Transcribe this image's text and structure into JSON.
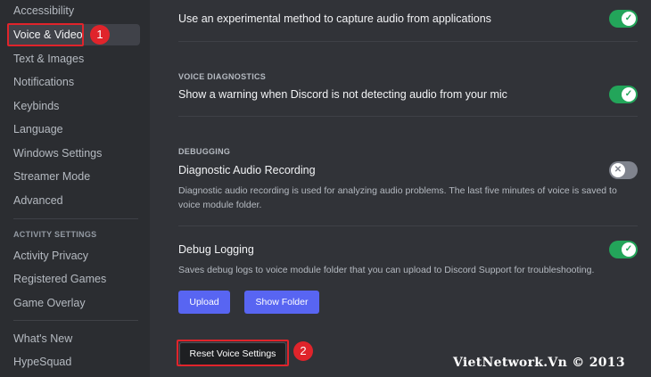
{
  "sidebar": {
    "items_top": [
      {
        "label": "Accessibility"
      },
      {
        "label": "Voice & Video",
        "selected": true
      },
      {
        "label": "Text & Images"
      },
      {
        "label": "Notifications"
      },
      {
        "label": "Keybinds"
      },
      {
        "label": "Language"
      },
      {
        "label": "Windows Settings"
      },
      {
        "label": "Streamer Mode"
      },
      {
        "label": "Advanced"
      }
    ],
    "activity_header": "ACTIVITY SETTINGS",
    "activity_items": [
      {
        "label": "Activity Privacy"
      },
      {
        "label": "Registered Games"
      },
      {
        "label": "Game Overlay"
      }
    ],
    "bottom_items": [
      {
        "label": "What's New"
      },
      {
        "label": "HypeSquad"
      }
    ]
  },
  "annotations": {
    "step1": "1",
    "step2": "2",
    "highlight_color": "#e0242b"
  },
  "main": {
    "experimental_capture": {
      "label": "Use an experimental method to capture audio from applications",
      "enabled": true
    },
    "voice_diagnostics": {
      "header": "VOICE DIAGNOSTICS",
      "label": "Show a warning when Discord is not detecting audio from your mic",
      "enabled": true
    },
    "debugging": {
      "header": "DEBUGGING",
      "diagnostic_recording": {
        "label": "Diagnostic Audio Recording",
        "enabled": false,
        "description": "Diagnostic audio recording is used for analyzing audio problems. The last five minutes of voice is saved to voice module folder."
      },
      "debug_logging": {
        "label": "Debug Logging",
        "enabled": true,
        "description": "Saves debug logs to voice module folder that you can upload to Discord Support for troubleshooting."
      },
      "upload_button": "Upload",
      "show_folder_button": "Show Folder"
    },
    "reset_button": "Reset Voice Settings"
  },
  "toggle_icons": {
    "on": "check-icon",
    "off": "x-icon"
  },
  "colors": {
    "toggle_on": "#23a55a",
    "toggle_off": "#80848e",
    "brand": "#5865f2"
  },
  "watermark": "VietNetwork.Vn © 2013"
}
